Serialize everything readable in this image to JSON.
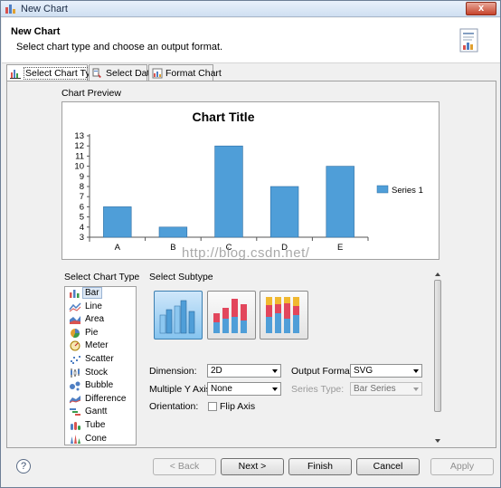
{
  "window": {
    "title": "New Chart",
    "close_label": "x"
  },
  "header": {
    "title": "New Chart",
    "description": "Select chart type and choose an output format."
  },
  "tabs": [
    {
      "label": "Select Chart Type",
      "active": true
    },
    {
      "label": "Select Data",
      "active": false
    },
    {
      "label": "Format Chart",
      "active": false
    }
  ],
  "preview": {
    "section_label": "Chart Preview",
    "chart_data": {
      "type": "bar",
      "title": "Chart Title",
      "categories": [
        "A",
        "B",
        "C",
        "D",
        "E"
      ],
      "series": [
        {
          "name": "Series 1",
          "values": [
            6,
            4,
            12,
            8,
            10
          ],
          "color": "#4f9ed8"
        }
      ],
      "ylim": [
        3,
        13
      ],
      "yticks": [
        3,
        4,
        5,
        6,
        7,
        8,
        9,
        10,
        11,
        12,
        13
      ],
      "grid": false,
      "legend": "right"
    },
    "watermark": "http://blog.csdn.net/"
  },
  "chart_type": {
    "section_label": "Select Chart Type",
    "items": [
      {
        "label": "Bar",
        "icon": "bar-icon",
        "selected": true
      },
      {
        "label": "Line",
        "icon": "line-icon",
        "selected": false
      },
      {
        "label": "Area",
        "icon": "area-icon",
        "selected": false
      },
      {
        "label": "Pie",
        "icon": "pie-icon",
        "selected": false
      },
      {
        "label": "Meter",
        "icon": "meter-icon",
        "selected": false
      },
      {
        "label": "Scatter",
        "icon": "scatter-icon",
        "selected": false
      },
      {
        "label": "Stock",
        "icon": "stock-icon",
        "selected": false
      },
      {
        "label": "Bubble",
        "icon": "bubble-icon",
        "selected": false
      },
      {
        "label": "Difference",
        "icon": "difference-icon",
        "selected": false
      },
      {
        "label": "Gantt",
        "icon": "gantt-icon",
        "selected": false
      },
      {
        "label": "Tube",
        "icon": "tube-icon",
        "selected": false
      },
      {
        "label": "Cone",
        "icon": "cone-icon",
        "selected": false
      }
    ]
  },
  "subtype": {
    "section_label": "Select Subtype",
    "options": [
      {
        "name": "side-by-side",
        "selected": true
      },
      {
        "name": "stacked",
        "selected": false
      },
      {
        "name": "percent-stacked",
        "selected": false
      }
    ]
  },
  "form": {
    "dimension_label": "Dimension:",
    "dimension_value": "2D",
    "multiple_y_label": "Multiple Y Axis:",
    "multiple_y_value": "None",
    "orientation_label": "Orientation:",
    "flip_axis_label": "Flip Axis",
    "flip_axis_checked": false,
    "output_format_label": "Output Format:",
    "output_format_value": "SVG",
    "series_type_label": "Series Type:",
    "series_type_value": "Bar Series"
  },
  "footer": {
    "help": "?",
    "back": "< Back",
    "next": "Next >",
    "finish": "Finish",
    "cancel": "Cancel",
    "apply": "Apply"
  }
}
